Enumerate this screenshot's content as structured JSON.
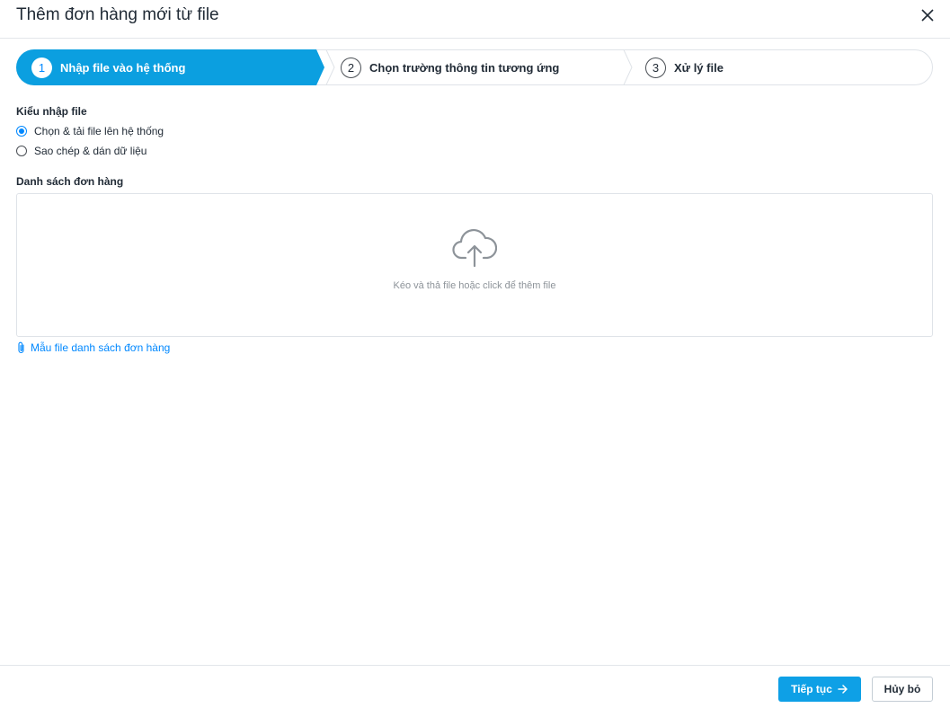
{
  "dialog": {
    "title": "Thêm đơn hàng mới từ file"
  },
  "stepper": {
    "steps": [
      {
        "number": "1",
        "label": "Nhập file vào hệ thống",
        "state": "active"
      },
      {
        "number": "2",
        "label": "Chọn trường thông tin tương ứng",
        "state": "inactive"
      },
      {
        "number": "3",
        "label": "Xử lý file",
        "state": "inactive"
      }
    ]
  },
  "import_type": {
    "label": "Kiểu nhập file",
    "options": [
      {
        "label": "Chọn & tải file lên hệ thống",
        "checked": true
      },
      {
        "label": "Sao chép & dán dữ liệu",
        "checked": false
      }
    ]
  },
  "order_list": {
    "label": "Danh sách đơn hàng",
    "dropzone_text": "Kéo và thả file hoặc click để thêm file",
    "upload_icon": "cloud-upload-icon"
  },
  "template_link": {
    "icon": "paperclip-icon",
    "label": "Mẫu file danh sách đơn hàng"
  },
  "footer": {
    "continue_label": "Tiếp tục",
    "continue_icon": "arrow-right-icon",
    "cancel_label": "Hủy bỏ"
  },
  "colors": {
    "accent": "#0088ff",
    "primary_button": "#0ea0e6",
    "border": "#dfe3e8"
  }
}
